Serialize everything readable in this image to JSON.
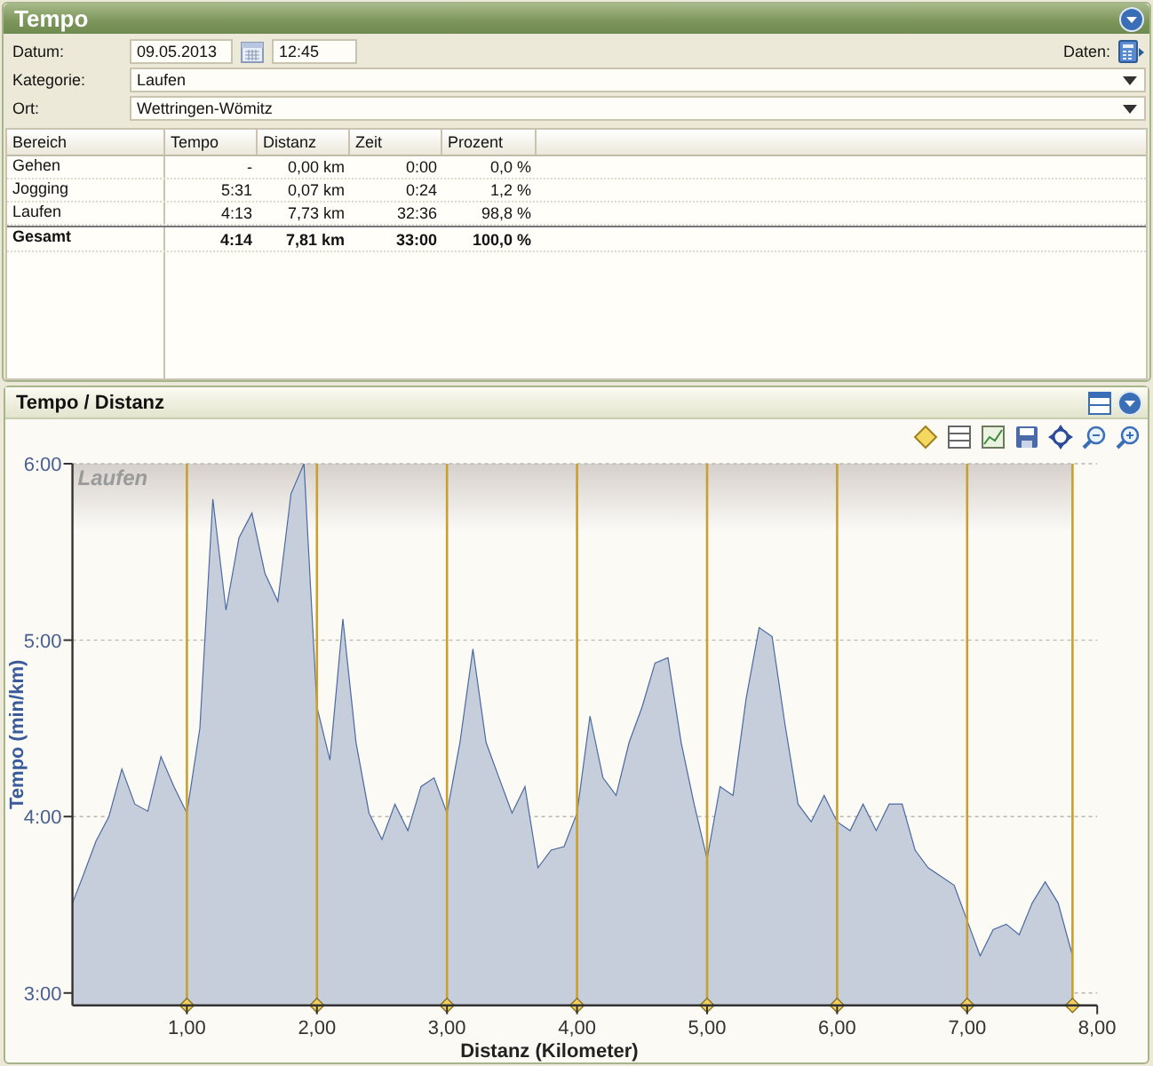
{
  "panel": {
    "title": "Tempo"
  },
  "form": {
    "date_label": "Datum:",
    "date": "09.05.2013",
    "time": "12:45",
    "data_label": "Daten:",
    "category_label": "Kategorie:",
    "category": "Laufen",
    "place_label": "Ort:",
    "place": "Wettringen-Wömitz"
  },
  "table": {
    "columns": [
      "Bereich",
      "Tempo",
      "Distanz",
      "Zeit",
      "Prozent"
    ],
    "rows": [
      {
        "cells": [
          "Gehen",
          "-",
          "0,00 km",
          "0:00",
          "0,0 %"
        ],
        "total": false
      },
      {
        "cells": [
          "Jogging",
          "5:31",
          "0,07 km",
          "0:24",
          "1,2 %"
        ],
        "total": false
      },
      {
        "cells": [
          "Laufen",
          "4:13",
          "7,73 km",
          "32:36",
          "98,8 %"
        ],
        "total": false
      },
      {
        "cells": [
          "Gesamt",
          "4:14",
          "7,81 km",
          "33:00",
          "100,0 %"
        ],
        "total": true
      }
    ]
  },
  "chart_panel": {
    "title": "Tempo / Distanz",
    "chart_data": {
      "type": "area",
      "xlabel": "Distanz (Kilometer)",
      "ylabel": "Tempo (min/km)",
      "x": [
        0.12,
        0.2,
        0.3,
        0.4,
        0.5,
        0.6,
        0.7,
        0.8,
        0.9,
        1.0,
        1.1,
        1.2,
        1.3,
        1.4,
        1.5,
        1.6,
        1.7,
        1.8,
        1.9,
        2.0,
        2.1,
        2.2,
        2.3,
        2.4,
        2.5,
        2.6,
        2.7,
        2.8,
        2.9,
        3.0,
        3.1,
        3.2,
        3.3,
        3.4,
        3.5,
        3.6,
        3.7,
        3.8,
        3.9,
        4.0,
        4.1,
        4.2,
        4.3,
        4.4,
        4.5,
        4.6,
        4.7,
        4.8,
        4.9,
        5.0,
        5.1,
        5.2,
        5.3,
        5.4,
        5.5,
        5.6,
        5.7,
        5.8,
        5.9,
        6.0,
        6.1,
        6.2,
        6.3,
        6.4,
        6.5,
        6.6,
        6.7,
        6.8,
        6.9,
        7.0,
        7.1,
        7.2,
        7.3,
        7.4,
        7.5,
        7.6,
        7.7,
        7.81
      ],
      "series": [
        {
          "color": "#4a6aa0",
          "values": [
            3.51,
            3.66,
            3.86,
            4.0,
            4.27,
            4.07,
            4.03,
            4.34,
            4.17,
            4.02,
            4.5,
            5.8,
            5.17,
            5.58,
            5.72,
            5.38,
            5.22,
            5.83,
            6.0,
            4.62,
            4.32,
            5.12,
            4.42,
            4.02,
            3.87,
            4.07,
            3.92,
            4.17,
            4.22,
            4.02,
            4.42,
            4.95,
            4.42,
            4.22,
            4.02,
            4.17,
            3.71,
            3.81,
            3.83,
            4.02,
            4.57,
            4.22,
            4.12,
            4.42,
            4.62,
            4.87,
            4.9,
            4.42,
            4.07,
            3.76,
            4.17,
            4.12,
            4.67,
            5.07,
            5.02,
            4.52,
            4.07,
            3.97,
            4.12,
            3.97,
            3.92,
            4.07,
            3.92,
            4.07,
            4.07,
            3.81,
            3.71,
            3.66,
            3.61,
            3.41,
            3.21,
            3.36,
            3.39,
            3.33,
            3.51,
            3.63,
            3.51,
            3.21
          ]
        }
      ],
      "xlim": [
        0.12,
        8.0
      ],
      "ylim": [
        2.93,
        6.0
      ],
      "xticks": [
        {
          "value": 1,
          "label": "1,00"
        },
        {
          "value": 2,
          "label": "2,00"
        },
        {
          "value": 3,
          "label": "3,00"
        },
        {
          "value": 4,
          "label": "4,00"
        },
        {
          "value": 5,
          "label": "5,00"
        },
        {
          "value": 6,
          "label": "6,00"
        },
        {
          "value": 7,
          "label": "7,00"
        },
        {
          "value": 8,
          "label": "8,00"
        }
      ],
      "yticks": [
        {
          "value": 3,
          "label": "3:00"
        },
        {
          "value": 4,
          "label": "4:00"
        },
        {
          "value": 5,
          "label": "5:00"
        },
        {
          "value": 6,
          "label": "6:00"
        }
      ],
      "grid": true,
      "bands": [
        {
          "axis": "x",
          "from": 0.12,
          "to": 7.81,
          "label": "Laufen"
        }
      ]
    }
  }
}
